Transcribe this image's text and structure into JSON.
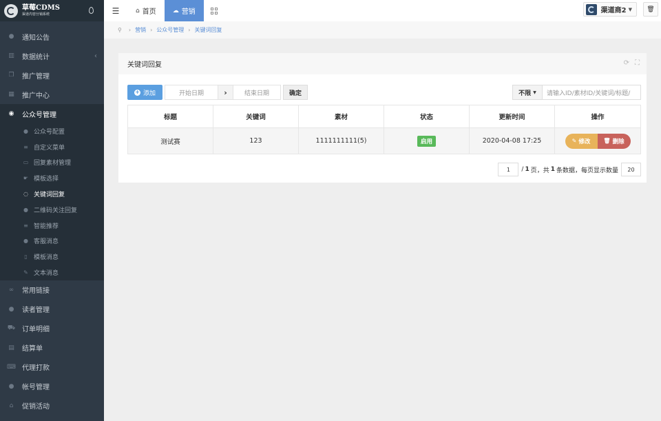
{
  "brand": {
    "title": "草莓CDMS",
    "subtitle": "渠道内容分销系统"
  },
  "sidebar": {
    "items": [
      {
        "label": "通知公告",
        "icon": "comment-icon"
      },
      {
        "label": "数据统计",
        "icon": "bar-chart-icon"
      },
      {
        "label": "推广管理",
        "icon": "copy-icon"
      },
      {
        "label": "推广中心",
        "icon": "building-icon"
      },
      {
        "label": "公众号管理",
        "icon": "wechat-icon"
      }
    ],
    "submenu": [
      {
        "label": "公众号配置",
        "icon": "comment-icon"
      },
      {
        "label": "自定义菜单",
        "icon": "list-icon"
      },
      {
        "label": "回复素材管理",
        "icon": "image-icon"
      },
      {
        "label": "模板选择",
        "icon": "hand-icon"
      },
      {
        "label": "关键词回复",
        "icon": "comments-icon"
      },
      {
        "label": "二维码关注回复",
        "icon": "comment-icon"
      },
      {
        "label": "智能推荐",
        "icon": "list-icon"
      },
      {
        "label": "客服消息",
        "icon": "user-icon"
      },
      {
        "label": "模板消息",
        "icon": "file-icon"
      },
      {
        "label": "文本消息",
        "icon": "edit-icon"
      }
    ],
    "items_after": [
      {
        "label": "常用链接",
        "icon": "link-icon"
      },
      {
        "label": "读者管理",
        "icon": "users-icon"
      },
      {
        "label": "订单明细",
        "icon": "cart-icon"
      },
      {
        "label": "结算单",
        "icon": "calculator-icon"
      },
      {
        "label": "代理打款",
        "icon": "keyboard-icon"
      },
      {
        "label": "帐号管理",
        "icon": "user-plus-icon"
      },
      {
        "label": "促销活动",
        "icon": "bank-icon"
      }
    ]
  },
  "topbar": {
    "tabs": [
      {
        "label": "首页",
        "icon": "home-icon"
      },
      {
        "label": "营销",
        "icon": "cloud-icon"
      }
    ],
    "user_name": "渠道商2"
  },
  "breadcrumb": [
    "营销",
    "公众号管理",
    "关键词回复"
  ],
  "panel": {
    "title": "关键词回复"
  },
  "toolbar": {
    "add_label": "添加",
    "start_date_placeholder": "开始日期",
    "end_date_placeholder": "结束日期",
    "confirm_label": "确定",
    "filter_value": "不限",
    "search_placeholder": "请输入ID/素材ID/关键词/标题/"
  },
  "table": {
    "headers": [
      "标题",
      "关键词",
      "素材",
      "状态",
      "更新时间",
      "操作"
    ],
    "rows": [
      {
        "title": "测试赛",
        "keyword": "123",
        "material": "1111111111(5)",
        "status": "启用",
        "updated": "2020-04-08 17:25",
        "edit": "修改",
        "delete": "删除"
      }
    ]
  },
  "pager": {
    "page": "1",
    "total_pages": "1",
    "text_page": "页，共",
    "total_records": "1",
    "text_records": "条数据，每页显示数量",
    "page_size": "20"
  },
  "colors": {
    "sidebar_bg": "#2f3a46",
    "accent": "#5b8fd6",
    "status_green": "#59b95a",
    "edit_orange": "#e8b35a",
    "delete_red": "#c8625b"
  }
}
